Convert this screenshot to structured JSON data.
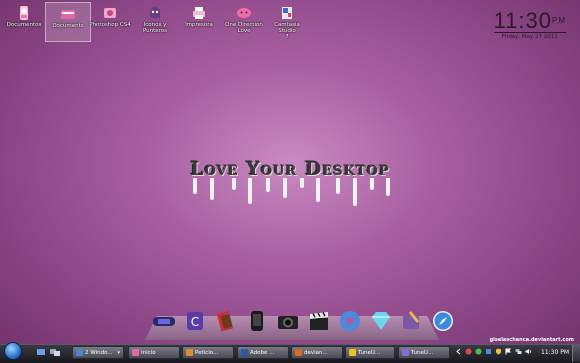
{
  "desktop_icons": [
    {
      "label": "Documentos",
      "icon": "pink-folder-icon"
    },
    {
      "label": "Documents",
      "icon": "pink-folder-icon"
    },
    {
      "label": "Photoshop CS4",
      "icon": "photoshop-icon"
    },
    {
      "label": "Iconos y Punteros",
      "icon": "ghost-folder-icon"
    },
    {
      "label": "Impresora",
      "icon": "printer-icon"
    },
    {
      "label": "One Direction\nLove",
      "icon": "pink-face-icon"
    },
    {
      "label": "Camtasia Studio\n7",
      "icon": "camtasia-icon"
    }
  ],
  "clock": {
    "time": "11:30",
    "ampm": "PM",
    "date": "Friday, May 27 2011"
  },
  "wallpaper": {
    "text": "Love Your Desktop"
  },
  "dock": {
    "items": [
      "game-console-icon",
      "camtasia-icon",
      "chocolate-icon",
      "iphone-icon",
      "camera-icon",
      "clapper-icon",
      "donut-icon",
      "diamond-icon",
      "tools-icon",
      "safari-icon"
    ]
  },
  "watermark": "giselaschanca.deviantart.com",
  "taskbar": {
    "buttons": [
      {
        "label": "2 Windo...",
        "color": "#4a86d6",
        "caret": true
      },
      {
        "label": "Inicio",
        "color": "#e06aa8",
        "caret": false
      },
      {
        "label": "Peticio...",
        "color": "#e08a2a",
        "caret": false
      },
      {
        "label": "Adobe ...",
        "color": "#2a5aa8",
        "caret": false
      },
      {
        "label": "devian...",
        "color": "#d86a2a",
        "caret": false
      },
      {
        "label": "TuneU...",
        "color": "#f0c020",
        "caret": false
      },
      {
        "label": "TuneU...",
        "color": "#8a6ad6",
        "caret": false
      }
    ],
    "clock": "11:30 PM",
    "colors": {
      "accent": "#a85fa0",
      "taskbar": "#16161c"
    }
  }
}
